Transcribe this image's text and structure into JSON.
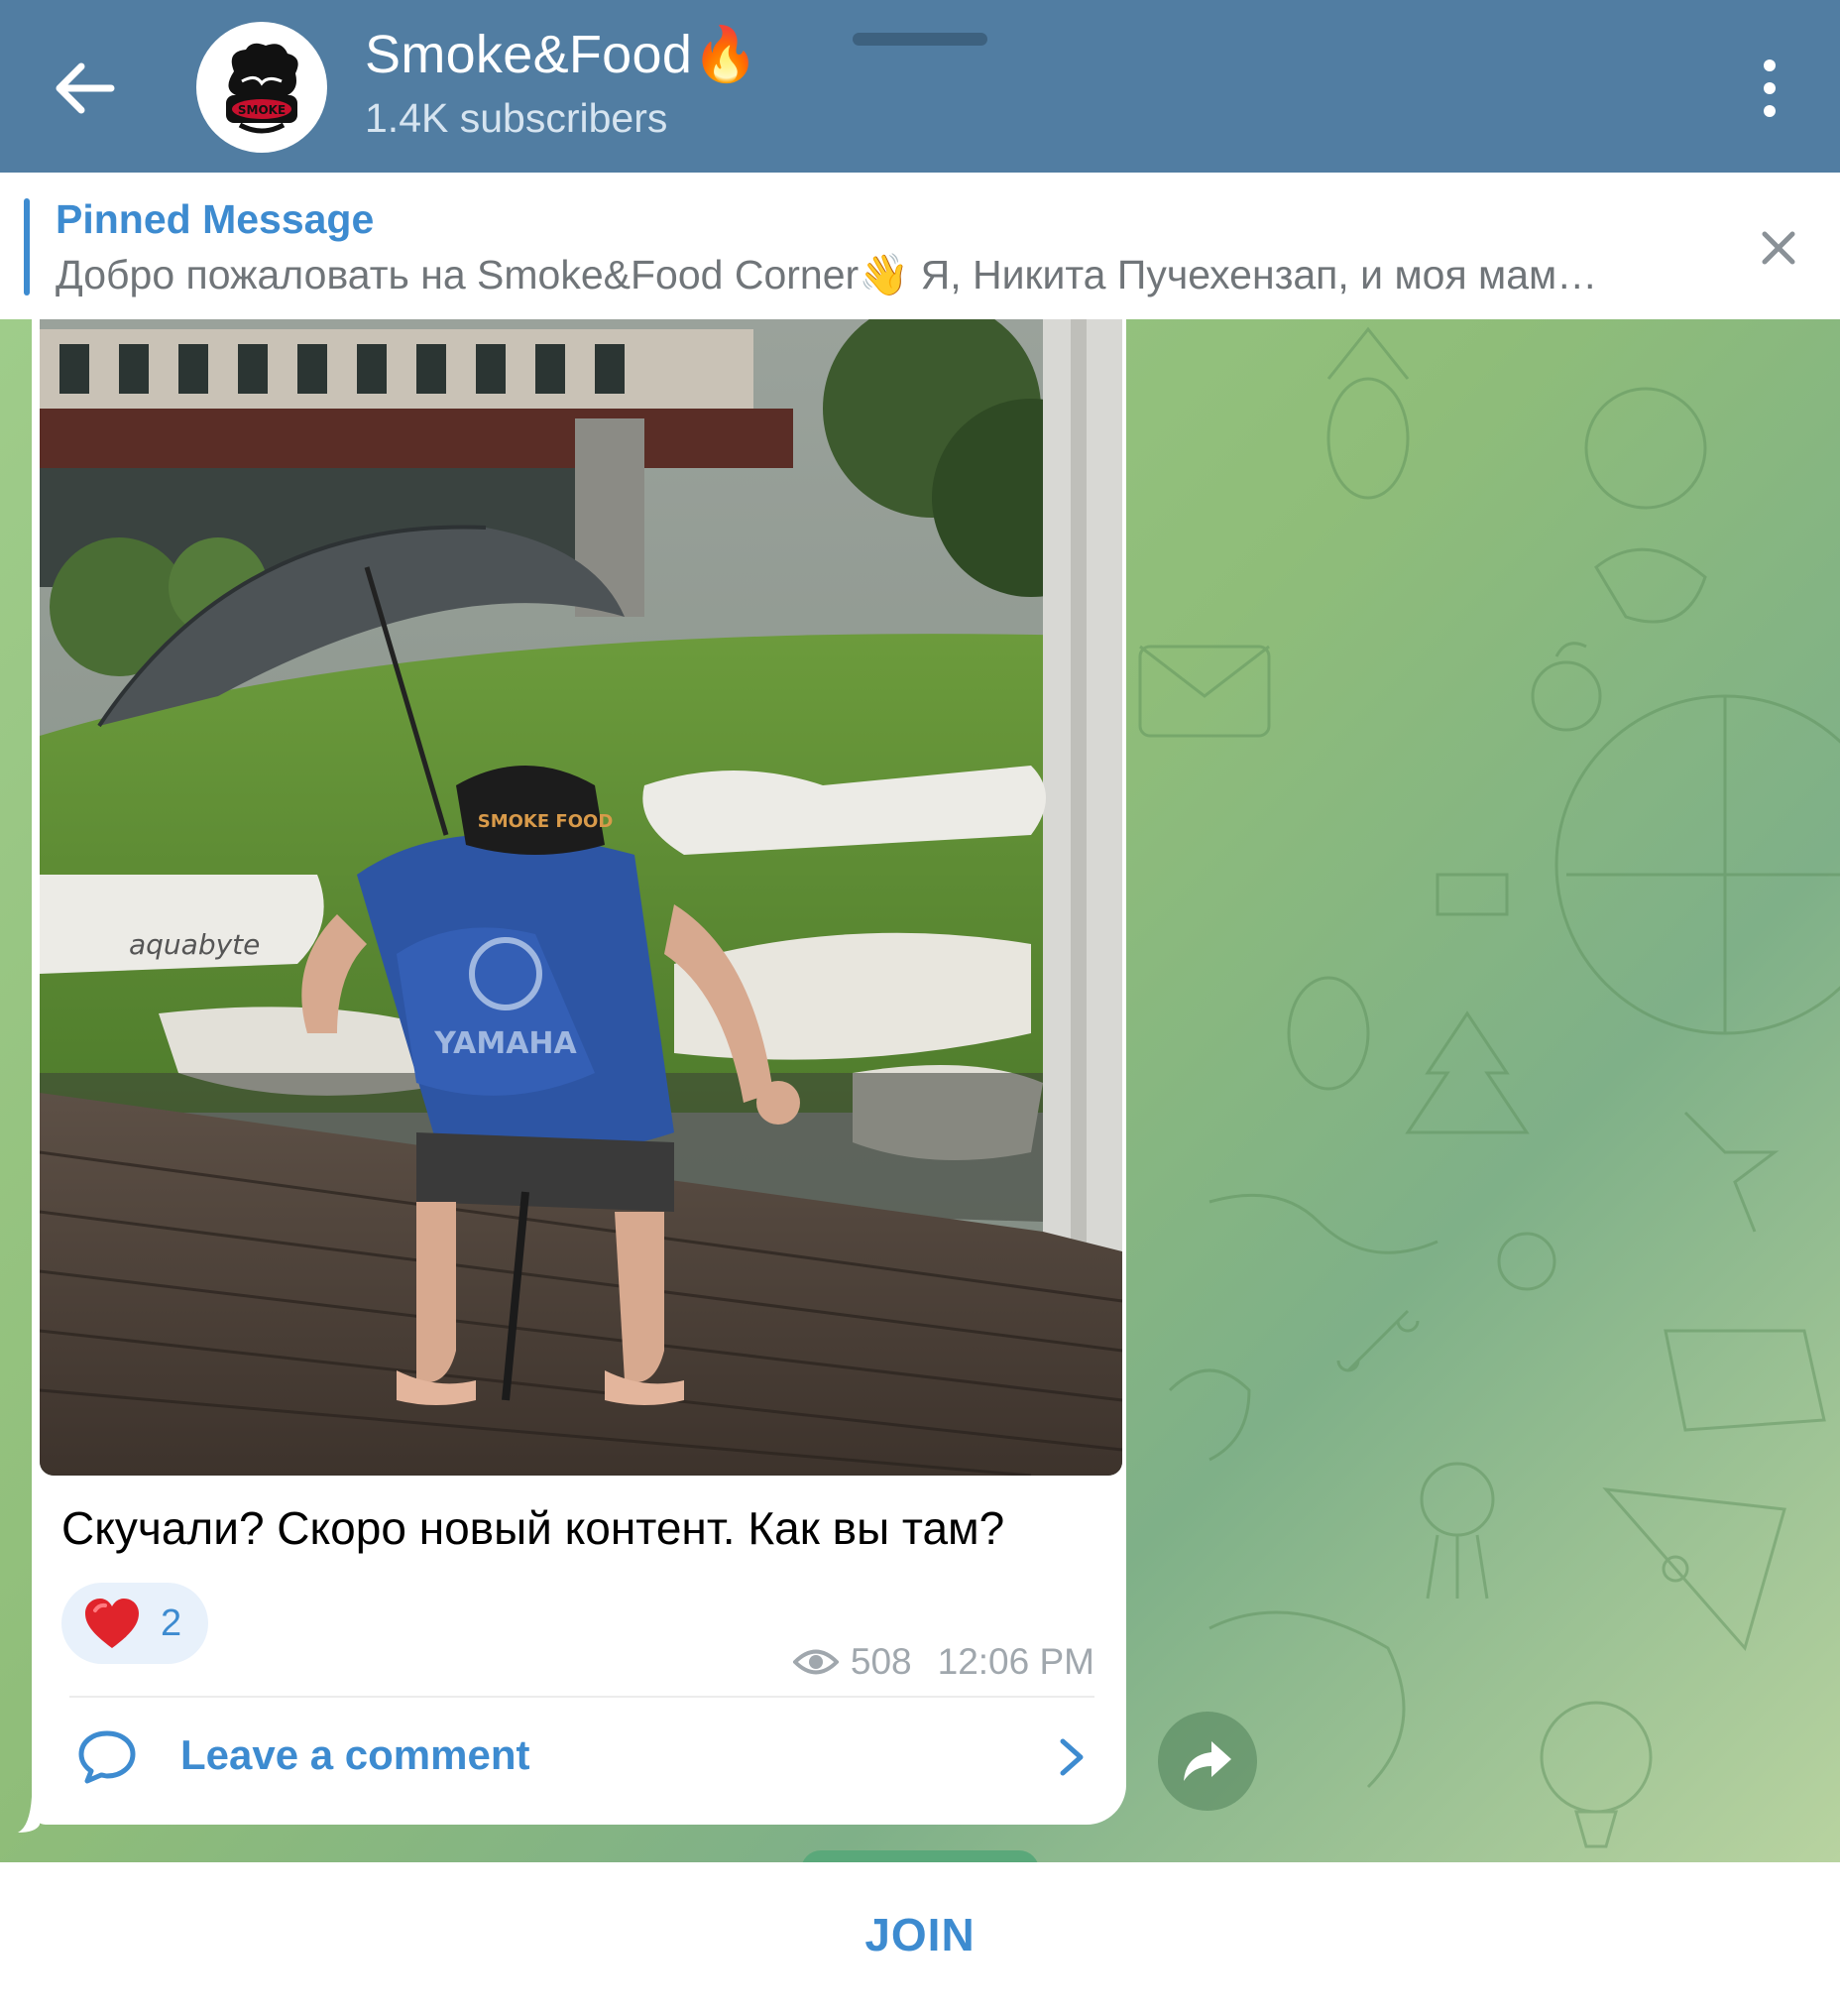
{
  "header": {
    "title": "Smoke&Food",
    "title_emoji": "🔥",
    "subtitle": "1.4K subscribers",
    "avatar_logo_text": "SMOKE FOOD"
  },
  "pinned": {
    "title": "Pinned Message",
    "text": "Добро пожаловать на Smoke&Food Corner👋 Я, Никита Пучехензап, и моя мам…"
  },
  "post": {
    "photo_alt": "Man in Yamaha life vest and Smoke Food cap holding umbrella on a wooden pier near pedal boats",
    "photo_texts": {
      "vest": "YAMAHA",
      "cap": "SMOKE FOOD",
      "boat": "aquabyte"
    },
    "caption": "Скучали? Скоро новый контент. Как вы там?",
    "reaction": {
      "emoji": "❤",
      "count": "2"
    },
    "views": "508",
    "time": "12:06 PM",
    "comment_label": "Leave a comment"
  },
  "bottom": {
    "join_label": "JOIN"
  },
  "icons": {
    "back": "arrow-left-icon",
    "more": "vertical-dots-icon",
    "close": "close-icon",
    "eye": "eye-icon",
    "comment": "comment-bubble-icon",
    "chevron": "chevron-right-icon",
    "share": "share-arrow-icon"
  },
  "colors": {
    "header_bg": "#517da2",
    "accent": "#3d8bd0",
    "chat_bg": "#9fcc8a",
    "muted_text": "#707579"
  }
}
